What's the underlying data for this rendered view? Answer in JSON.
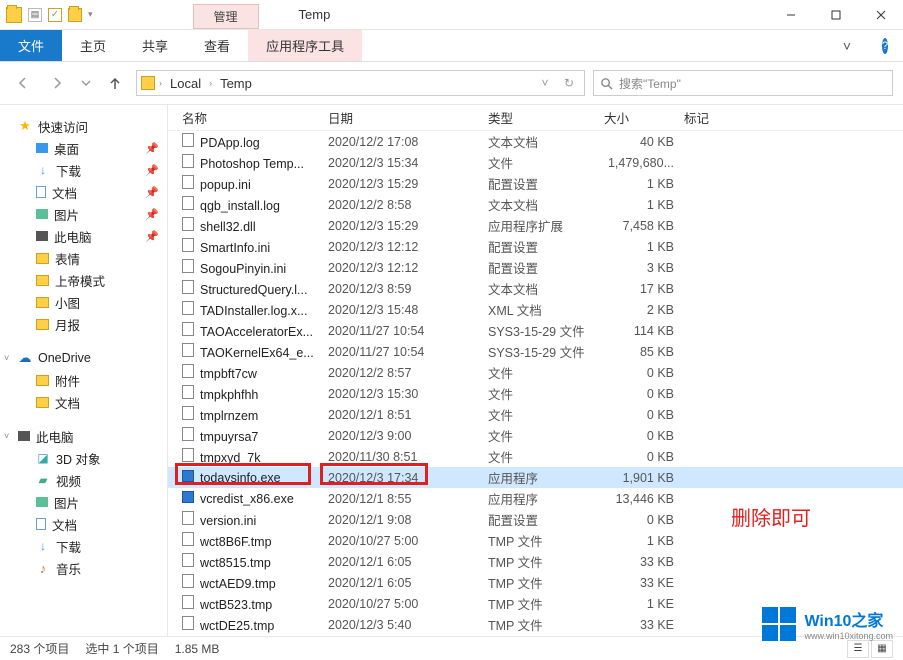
{
  "title": "Temp",
  "ribbon": {
    "manage": "管理",
    "file": "文件",
    "home": "主页",
    "share": "共享",
    "view": "查看",
    "context": "应用程序工具"
  },
  "breadcrumb": {
    "items": [
      "Local",
      "Temp"
    ]
  },
  "search": {
    "placeholder": "搜索\"Temp\""
  },
  "sidebar": {
    "quick": "快速访问",
    "desktop": "桌面",
    "downloads": "下载",
    "documents": "文档",
    "pictures": "图片",
    "thispc": "此电脑",
    "emo": "表情",
    "godmode": "上帝模式",
    "xiaotu": "小图",
    "yuebao": "月报",
    "onedrive": "OneDrive",
    "fujian": "附件",
    "wendang2": "文档",
    "thispc2": "此电脑",
    "obj3d": "3D 对象",
    "video": "视频",
    "pictures2": "图片",
    "documents2": "文档",
    "downloads2": "下载",
    "music": "音乐"
  },
  "columns": {
    "name": "名称",
    "date": "日期",
    "type": "类型",
    "size": "大小",
    "tag": "标记"
  },
  "files": [
    {
      "ico": "doc",
      "name": "PDApp.log",
      "date": "2020/12/2 17:08",
      "type": "文本文档",
      "size": "40 KB"
    },
    {
      "ico": "doc",
      "name": "Photoshop Temp...",
      "date": "2020/12/3 15:34",
      "type": "文件",
      "size": "1,479,680..."
    },
    {
      "ico": "ini",
      "name": "popup.ini",
      "date": "2020/12/3 15:29",
      "type": "配置设置",
      "size": "1 KB"
    },
    {
      "ico": "doc",
      "name": "qgb_install.log",
      "date": "2020/12/2 8:58",
      "type": "文本文档",
      "size": "1 KB"
    },
    {
      "ico": "dll",
      "name": "shell32.dll",
      "date": "2020/12/3 15:29",
      "type": "应用程序扩展",
      "size": "7,458 KB"
    },
    {
      "ico": "ini",
      "name": "SmartInfo.ini",
      "date": "2020/12/3 12:12",
      "type": "配置设置",
      "size": "1 KB"
    },
    {
      "ico": "ini",
      "name": "SogouPinyin.ini",
      "date": "2020/12/3 12:12",
      "type": "配置设置",
      "size": "3 KB"
    },
    {
      "ico": "doc",
      "name": "StructuredQuery.l...",
      "date": "2020/12/3 8:59",
      "type": "文本文档",
      "size": "17 KB"
    },
    {
      "ico": "doc",
      "name": "TADInstaller.log.x...",
      "date": "2020/12/3 15:48",
      "type": "XML 文档",
      "size": "2 KB"
    },
    {
      "ico": "doc",
      "name": "TAOAcceleratorEx...",
      "date": "2020/11/27 10:54",
      "type": "SYS3-15-29 文件",
      "size": "114 KB"
    },
    {
      "ico": "doc",
      "name": "TAOKernelEx64_e...",
      "date": "2020/11/27 10:54",
      "type": "SYS3-15-29 文件",
      "size": "85 KB"
    },
    {
      "ico": "doc",
      "name": "tmpbft7cw",
      "date": "2020/12/2 8:57",
      "type": "文件",
      "size": "0 KB"
    },
    {
      "ico": "doc",
      "name": "tmpkphfhh",
      "date": "2020/12/3 15:30",
      "type": "文件",
      "size": "0 KB"
    },
    {
      "ico": "doc",
      "name": "tmplrnzem",
      "date": "2020/12/1 8:51",
      "type": "文件",
      "size": "0 KB"
    },
    {
      "ico": "doc",
      "name": "tmpuyrsa7",
      "date": "2020/12/3 9:00",
      "type": "文件",
      "size": "0 KB"
    },
    {
      "ico": "doc",
      "name": "tmpxyd_7k",
      "date": "2020/11/30 8:51",
      "type": "文件",
      "size": "0 KB"
    },
    {
      "ico": "exe",
      "name": "todaysinfo.exe",
      "date": "2020/12/3 17:34",
      "type": "应用程序",
      "size": "1,901 KB",
      "selected": true
    },
    {
      "ico": "exe",
      "name": "vcredist_x86.exe",
      "date": "2020/12/1 8:55",
      "type": "应用程序",
      "size": "13,446 KB"
    },
    {
      "ico": "ini",
      "name": "version.ini",
      "date": "2020/12/1 9:08",
      "type": "配置设置",
      "size": "0 KB"
    },
    {
      "ico": "doc",
      "name": "wct8B6F.tmp",
      "date": "2020/10/27 5:00",
      "type": "TMP 文件",
      "size": "1 KB"
    },
    {
      "ico": "doc",
      "name": "wct8515.tmp",
      "date": "2020/12/1 6:05",
      "type": "TMP 文件",
      "size": "33 KB"
    },
    {
      "ico": "doc",
      "name": "wctAED9.tmp",
      "date": "2020/12/1 6:05",
      "type": "TMP 文件",
      "size": "33 KE"
    },
    {
      "ico": "doc",
      "name": "wctB523.tmp",
      "date": "2020/10/27 5:00",
      "type": "TMP 文件",
      "size": "1 KE"
    },
    {
      "ico": "doc",
      "name": "wctDE25.tmp",
      "date": "2020/12/3 5:40",
      "type": "TMP 文件",
      "size": "33 KE"
    }
  ],
  "status": {
    "count": "283 个项目",
    "selection": "选中 1 个项目",
    "size": "1.85 MB"
  },
  "annotation": "删除即可",
  "watermark": {
    "title": "Win10之家",
    "url": "www.win10xitong.com"
  }
}
